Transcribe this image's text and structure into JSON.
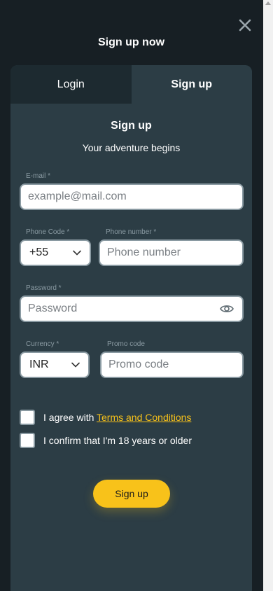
{
  "modal": {
    "title": "Sign up now",
    "close_icon": "close-icon"
  },
  "tabs": [
    {
      "label": "Login",
      "active": false
    },
    {
      "label": "Sign up",
      "active": true
    }
  ],
  "form": {
    "title": "Sign up",
    "subtitle": "Your adventure begins",
    "email": {
      "label": "E-mail *",
      "placeholder": "example@mail.com",
      "value": ""
    },
    "phone_code": {
      "label": "Phone Code *",
      "value": "+55"
    },
    "phone_number": {
      "label": "Phone number *",
      "placeholder": "Phone number",
      "value": ""
    },
    "password": {
      "label": "Password *",
      "placeholder": "Password",
      "value": "",
      "toggle_icon": "eye-icon"
    },
    "currency": {
      "label": "Currency *",
      "value": "INR"
    },
    "promo_code": {
      "label": "Promo code",
      "placeholder": "Promo code",
      "value": ""
    },
    "agree_terms": {
      "text": "I agree with ",
      "link": "Terms and Conditions",
      "checked": false
    },
    "age_confirm": {
      "text": "I confirm that I'm 18 years or older",
      "checked": false
    },
    "submit_label": "Sign up"
  },
  "colors": {
    "background": "#171f24",
    "panel": "#2c3d45",
    "accent": "#f8c21a"
  }
}
